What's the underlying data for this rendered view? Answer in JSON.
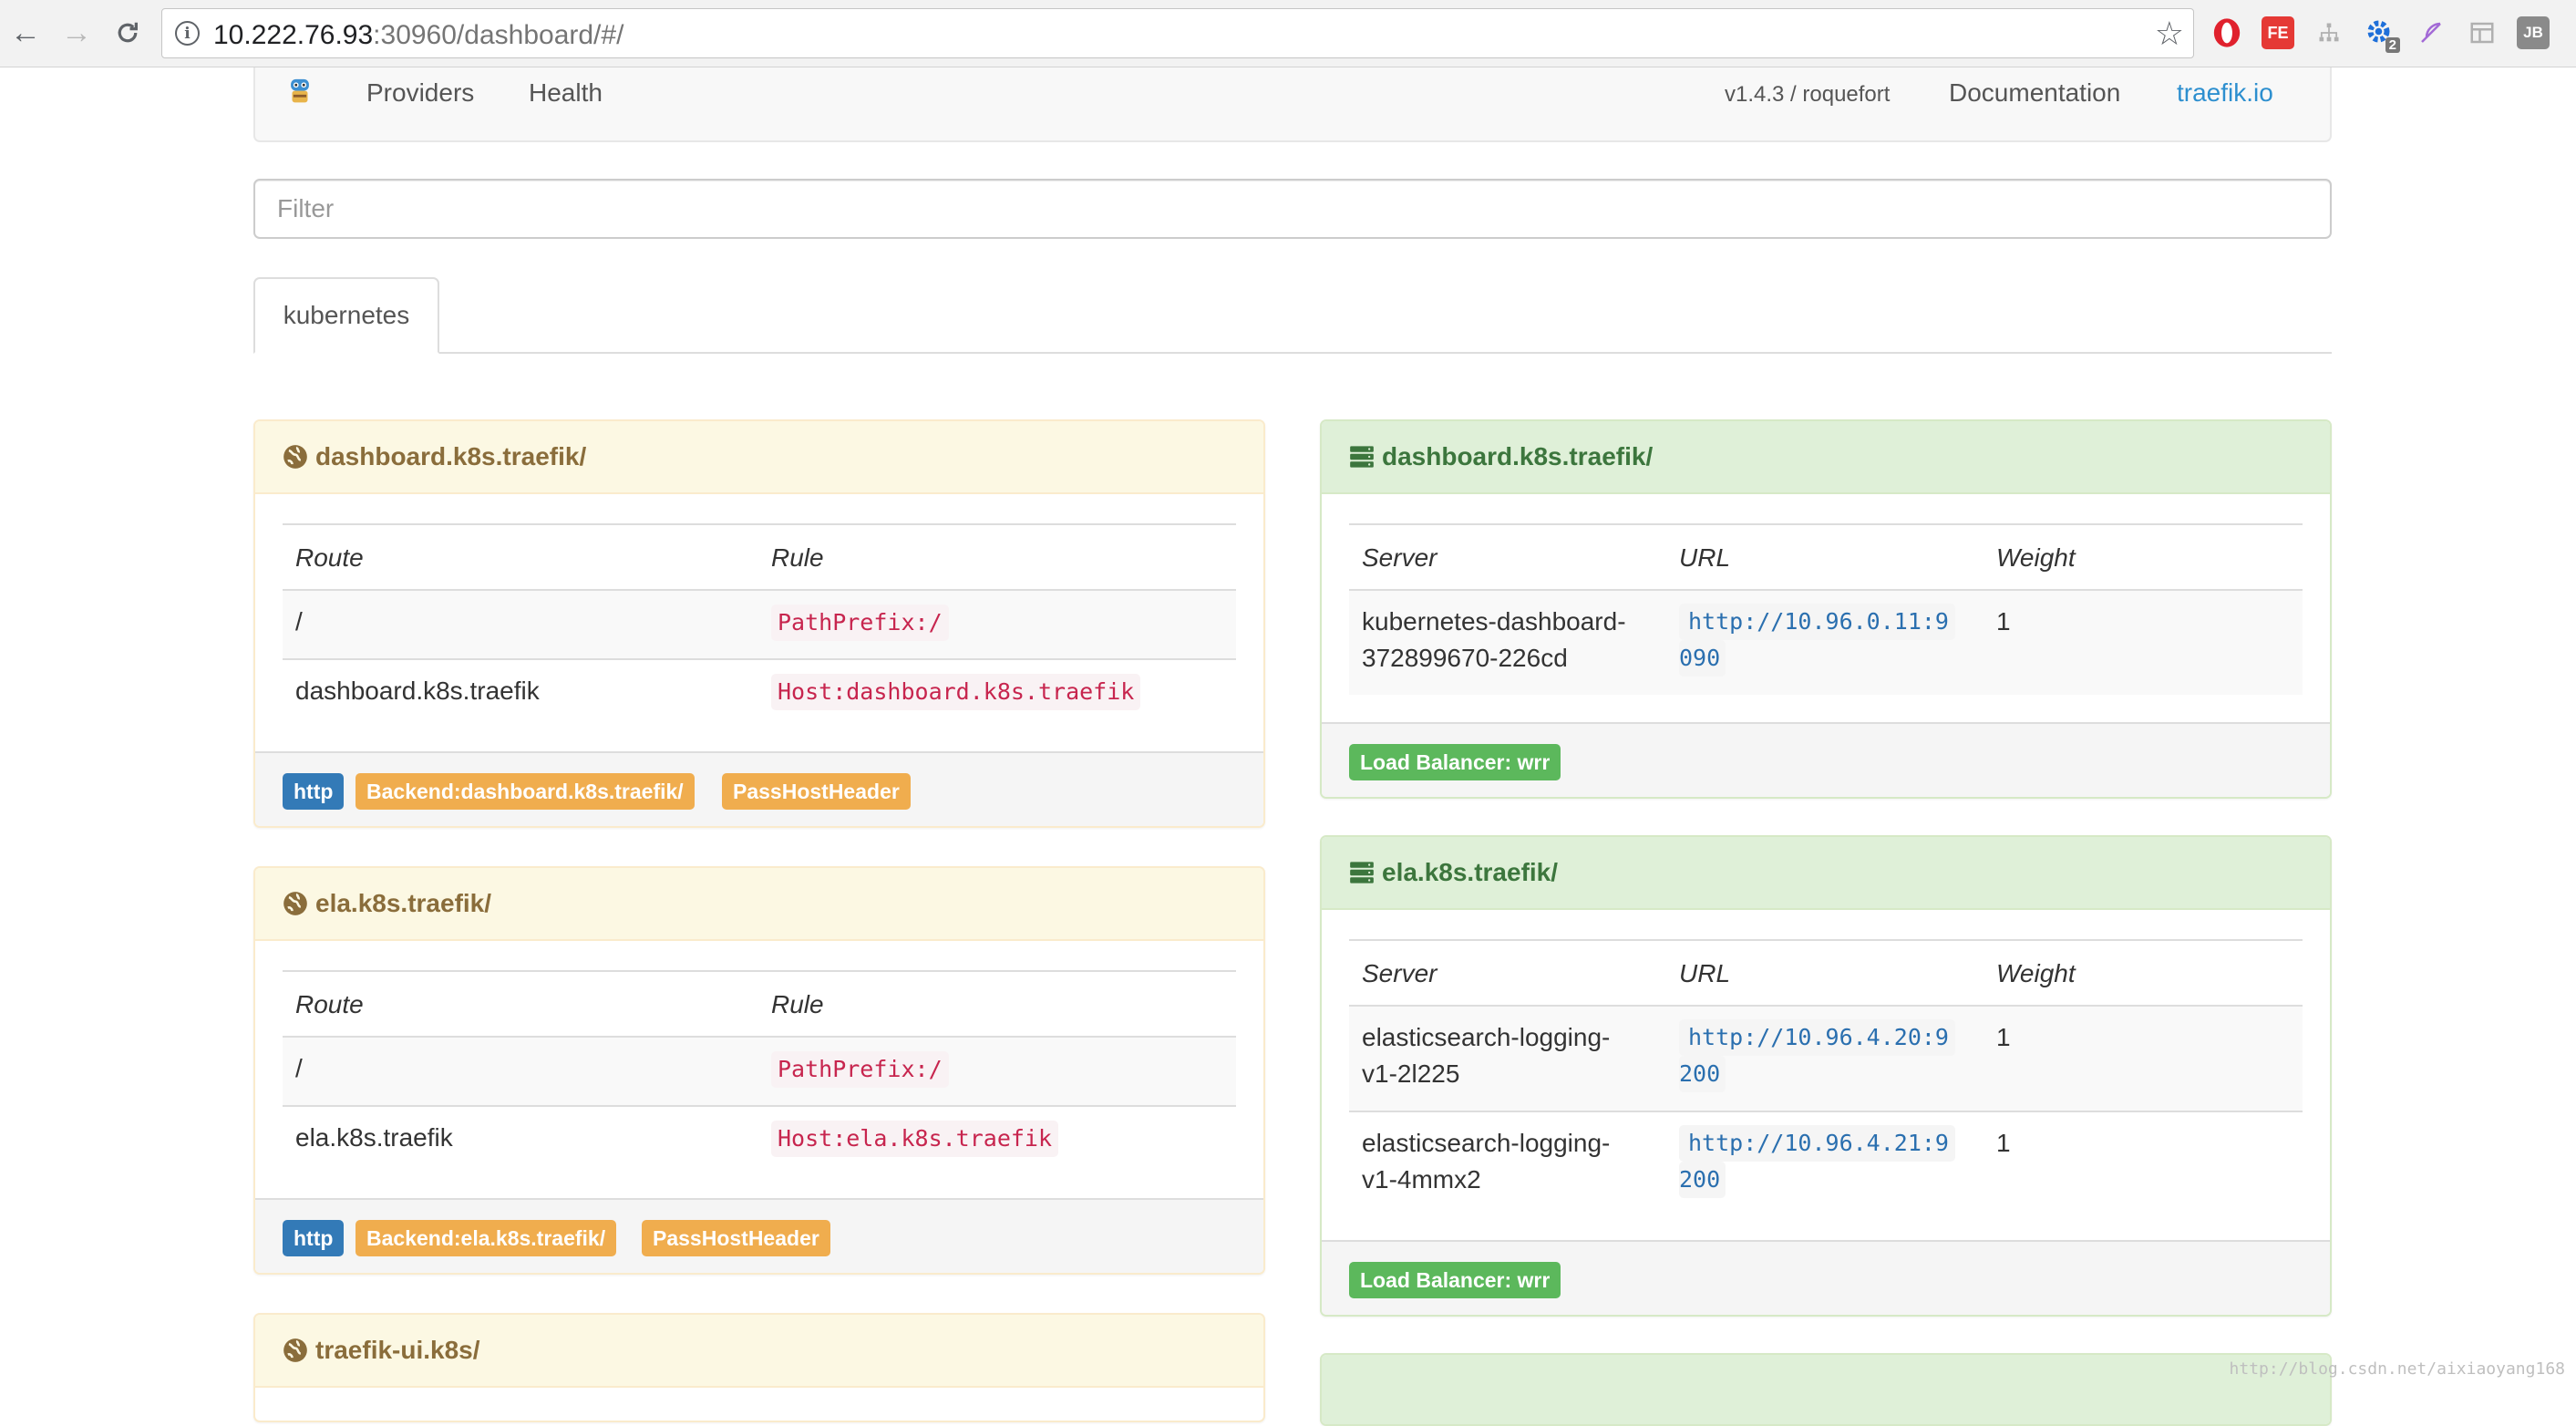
{
  "browser": {
    "url_host": "10.222.76.93",
    "url_path": ":30960/dashboard/#/",
    "extensions": [
      "opera-icon",
      "fe-icon",
      "sitemap-icon",
      "gear-badge-icon",
      "feather-icon",
      "panel-icon",
      "jb-icon"
    ],
    "ext_fe_label": "FE",
    "ext_jb_label": "JB",
    "ext_gear_badge": "2"
  },
  "navbar": {
    "providers": "Providers",
    "health": "Health",
    "version": "v1.4.3 / roquefort",
    "documentation": "Documentation",
    "site": "traefik.io"
  },
  "filter": {
    "placeholder": "Filter"
  },
  "tabs": [
    {
      "label": "kubernetes"
    }
  ],
  "frontends": [
    {
      "title": "dashboard.k8s.traefik/",
      "col_route": "Route",
      "col_rule": "Rule",
      "routes": [
        {
          "route": "/",
          "rule": "PathPrefix:/"
        },
        {
          "route": "dashboard.k8s.traefik",
          "rule": "Host:dashboard.k8s.traefik"
        }
      ],
      "labels": [
        "http",
        "Backend:dashboard.k8s.traefik/",
        "PassHostHeader"
      ]
    },
    {
      "title": "ela.k8s.traefik/",
      "col_route": "Route",
      "col_rule": "Rule",
      "routes": [
        {
          "route": "/",
          "rule": "PathPrefix:/"
        },
        {
          "route": "ela.k8s.traefik",
          "rule": "Host:ela.k8s.traefik"
        }
      ],
      "labels": [
        "http",
        "Backend:ela.k8s.traefik/",
        "PassHostHeader"
      ]
    },
    {
      "title": "traefik-ui.k8s/"
    }
  ],
  "backends": [
    {
      "title": "dashboard.k8s.traefik/",
      "col_server": "Server",
      "col_url": "URL",
      "col_weight": "Weight",
      "servers": [
        {
          "server_l1": "kubernetes-dashboard-",
          "server_l2": "372899670-226cd",
          "url_l1": "http://10.96.0.11:9",
          "url_l2": "090",
          "weight": "1"
        }
      ],
      "load_balancer": "Load Balancer: wrr"
    },
    {
      "title": "ela.k8s.traefik/",
      "col_server": "Server",
      "col_url": "URL",
      "col_weight": "Weight",
      "servers": [
        {
          "server_l1": "elasticsearch-logging-",
          "server_l2": "v1-2l225",
          "url_l1": "http://10.96.4.20:9",
          "url_l2": "200",
          "weight": "1"
        },
        {
          "server_l1": "elasticsearch-logging-",
          "server_l2": "v1-4mmx2",
          "url_l1": "http://10.96.4.21:9",
          "url_l2": "200",
          "weight": "1"
        }
      ],
      "load_balancer": "Load Balancer: wrr"
    }
  ],
  "watermark": "http://blog.csdn.net/aixiaoyang168",
  "colors": {
    "warning_header": "#fcf8e3",
    "success_header": "#dff0d8",
    "label_primary": "#337ab7",
    "label_warning": "#f0ad4e",
    "label_success": "#5cb85c",
    "link": "#2d8fcf"
  }
}
